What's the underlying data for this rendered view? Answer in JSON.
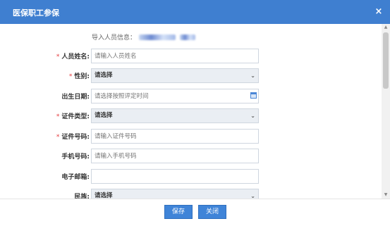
{
  "dialog": {
    "title": "医保职工参保",
    "close_glyph": "×"
  },
  "import_info": {
    "label": "导入人员信息："
  },
  "form": {
    "fields": [
      {
        "label": "人员姓名:",
        "required": true,
        "type": "text",
        "placeholder": "请输入人员姓名",
        "value": ""
      },
      {
        "label": "性别:",
        "required": true,
        "type": "select",
        "value": "请选择"
      },
      {
        "label": "出生日期:",
        "required": false,
        "type": "date",
        "placeholder": "请选择按照评定时间",
        "value": ""
      },
      {
        "label": "证件类型:",
        "required": true,
        "type": "select",
        "value": "请选择"
      },
      {
        "label": "证件号码:",
        "required": true,
        "type": "text",
        "placeholder": "请输入证件号码",
        "value": ""
      },
      {
        "label": "手机号码:",
        "required": false,
        "type": "text",
        "placeholder": "请输入手机号码",
        "value": ""
      },
      {
        "label": "电子邮箱:",
        "required": false,
        "type": "text",
        "placeholder": "",
        "value": ""
      },
      {
        "label": "民族:",
        "required": false,
        "type": "select",
        "value": "请选择"
      }
    ]
  },
  "footer": {
    "save_label": "保存",
    "close_label": "关闭"
  },
  "icons": {
    "dropdown": "chevron-down-icon",
    "calendar": "calendar-icon"
  },
  "colors": {
    "titlebar": "#3f7fd0",
    "button": "#3f84d8",
    "required": "#e4393c",
    "select_bg": "#eaeef3"
  }
}
